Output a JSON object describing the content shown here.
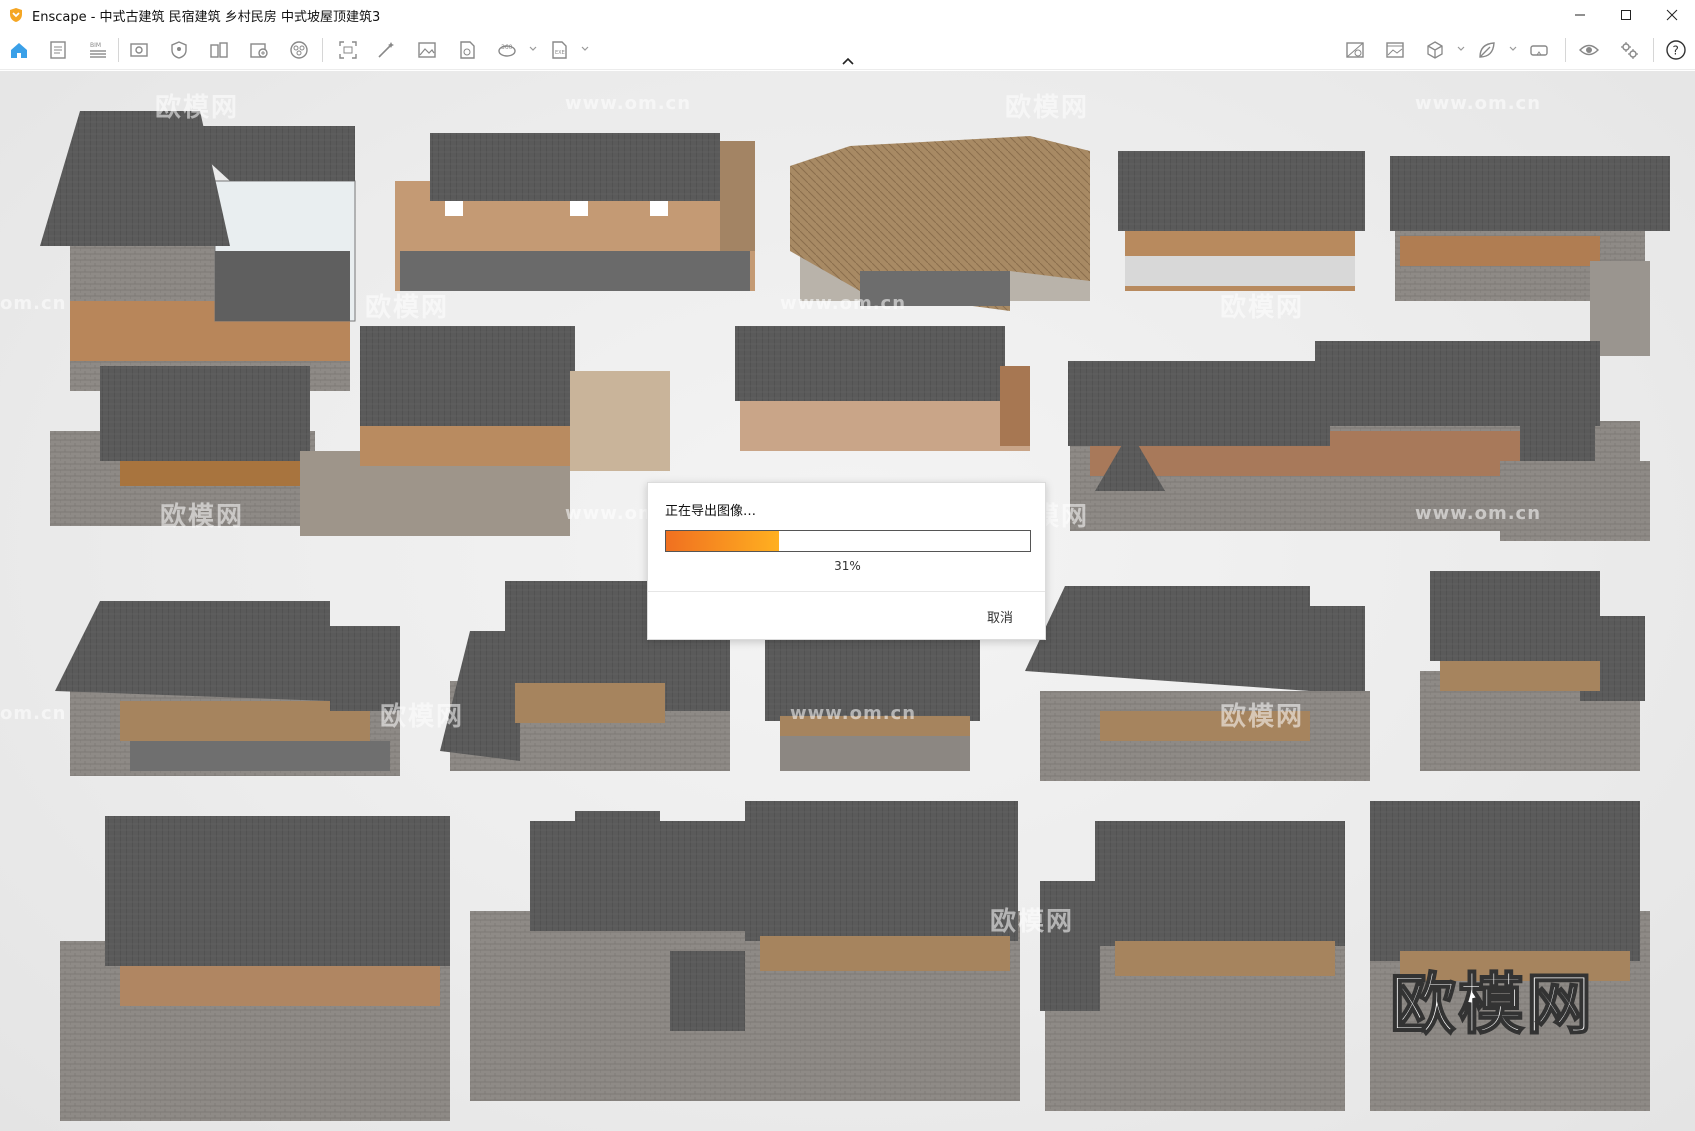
{
  "window": {
    "title": "Enscape - 中式古建筑 民宿建筑 乡村民房 中式坡屋顶建筑3",
    "logo_color": "#f5a623",
    "controls": [
      "minimize",
      "maximize",
      "close"
    ]
  },
  "toolbar": {
    "left_tools": [
      {
        "name": "home-icon",
        "label": "Home"
      },
      {
        "name": "document-icon",
        "label": "Documents"
      },
      {
        "name": "bim-icon",
        "label": "BIM"
      },
      {
        "name": "view-icon",
        "label": "View"
      },
      {
        "name": "shield-icon",
        "label": "Safe Frame"
      },
      {
        "name": "views-icon",
        "label": "Views"
      },
      {
        "name": "asset-library-icon",
        "label": "Asset Library"
      },
      {
        "name": "materials-icon",
        "label": "Materials"
      },
      {
        "name": "screenshot-icon",
        "label": "Screenshot"
      },
      {
        "name": "magic-wand-icon",
        "label": "Batch Rendering"
      },
      {
        "name": "image-icon",
        "label": "Render Image"
      },
      {
        "name": "panorama-file-icon",
        "label": "Panorama"
      },
      {
        "name": "360-panorama-icon",
        "label": "360 Panorama"
      },
      {
        "name": "export-file-icon",
        "label": "Export"
      }
    ],
    "right_tools": [
      {
        "name": "image-compare-icon",
        "label": "Image"
      },
      {
        "name": "gallery-icon",
        "label": "Gallery"
      },
      {
        "name": "cube-icon",
        "label": "Cube"
      },
      {
        "name": "leaf-icon",
        "label": "Leaf"
      },
      {
        "name": "vr-headset-icon",
        "label": "VR"
      },
      {
        "name": "eye-icon",
        "label": "Eye"
      },
      {
        "name": "settings-icon",
        "label": "Settings"
      },
      {
        "name": "help-icon",
        "label": "Help"
      }
    ]
  },
  "viewport": {
    "watermarks": [
      "欧模网",
      "www.om.cn",
      "欧模网",
      "www.om.cn",
      "om.cn",
      "欧模网",
      "www.om.cn",
      "欧模网",
      "欧模网",
      "www.om.cn",
      "欧模网",
      "www.om.cn",
      "om.cn",
      "欧模网",
      "www.om.cn",
      "欧模网",
      "欧模网"
    ],
    "brand_watermark": "欧模网",
    "roof_color": "#5c5c5c",
    "wood_color": "#a0704a",
    "stone_color": "#8e8a86"
  },
  "export_dialog": {
    "title": "正在导出图像…",
    "progress_percent": 31,
    "progress_label": "31%",
    "cancel_label": "取消",
    "progress_color_start": "#f07020",
    "progress_color_end": "#ffb020"
  }
}
